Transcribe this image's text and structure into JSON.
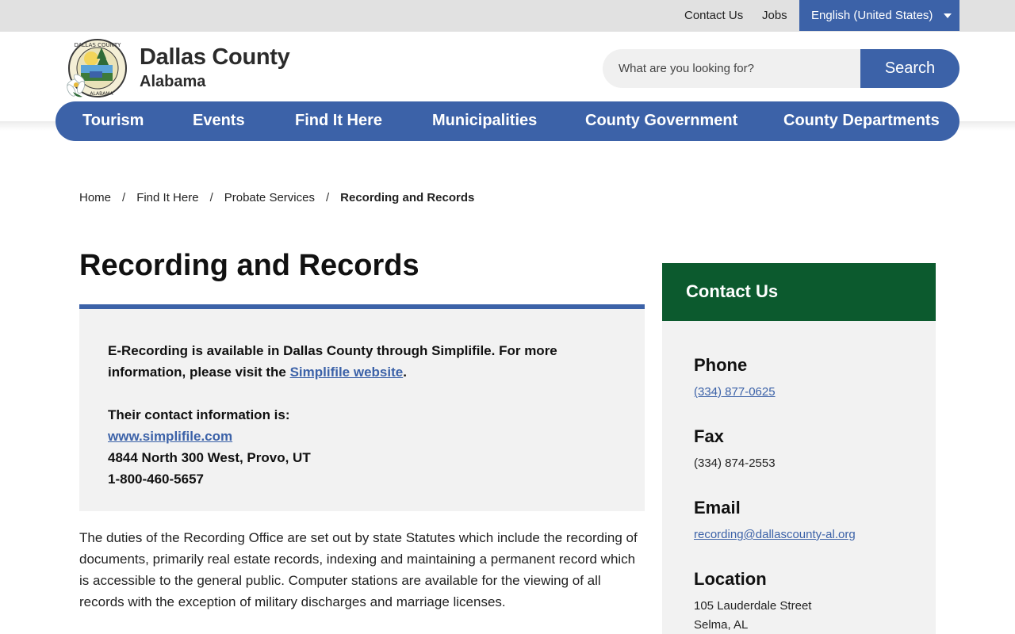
{
  "utility": {
    "contact_us": "Contact Us",
    "jobs": "Jobs",
    "language": "English (United States)"
  },
  "header": {
    "title": "Dallas County",
    "subtitle": "Alabama",
    "seal_text": "DALLAS COUNTY ALABAMA"
  },
  "search": {
    "placeholder": "What are you looking for?",
    "button": "Search"
  },
  "nav": {
    "items": [
      "Tourism",
      "Events",
      "Find It Here",
      "Municipalities",
      "County Government",
      "County Departments"
    ]
  },
  "breadcrumb": {
    "items": [
      "Home",
      "Find It Here",
      "Probate Services"
    ],
    "current": "Recording and Records",
    "separator": "/"
  },
  "page": {
    "title": "Recording and Records"
  },
  "info": {
    "intro_before_link": "E-Recording is available in Dallas County through Simplifile. For more information, please visit the ",
    "intro_link": "Simplifile website",
    "intro_after_link": ".",
    "contact_heading": "Their contact information is:",
    "website": "www.simplifile.com",
    "address": "4844 North 300 West, Provo, UT",
    "phone": "1-800-460-5657"
  },
  "body": {
    "paragraph": "The duties of the Recording Office are set out by state Statutes which include the recording of documents, primarily real estate records, indexing and maintaining a permanent record which is accessible to the general public. Computer stations are available for the viewing of all records with the exception of military discharges and marriage licenses."
  },
  "contact": {
    "title": "Contact Us",
    "phone_label": "Phone",
    "phone": "(334) 877-0625",
    "fax_label": "Fax",
    "fax": "(334) 874-2553",
    "email_label": "Email",
    "email": "recording@dallascounty-al.org",
    "location_label": "Location",
    "street": "105 Lauderdale Street",
    "city": "Selma, AL"
  },
  "colors": {
    "brand_blue": "#3c62a8",
    "contact_green": "#0c5a2e",
    "utility_gray": "#e1e1e1",
    "panel_gray": "#f2f2f2"
  },
  "icons": {
    "language_caret": "chevron-down-icon",
    "seal": "county-seal-icon"
  }
}
